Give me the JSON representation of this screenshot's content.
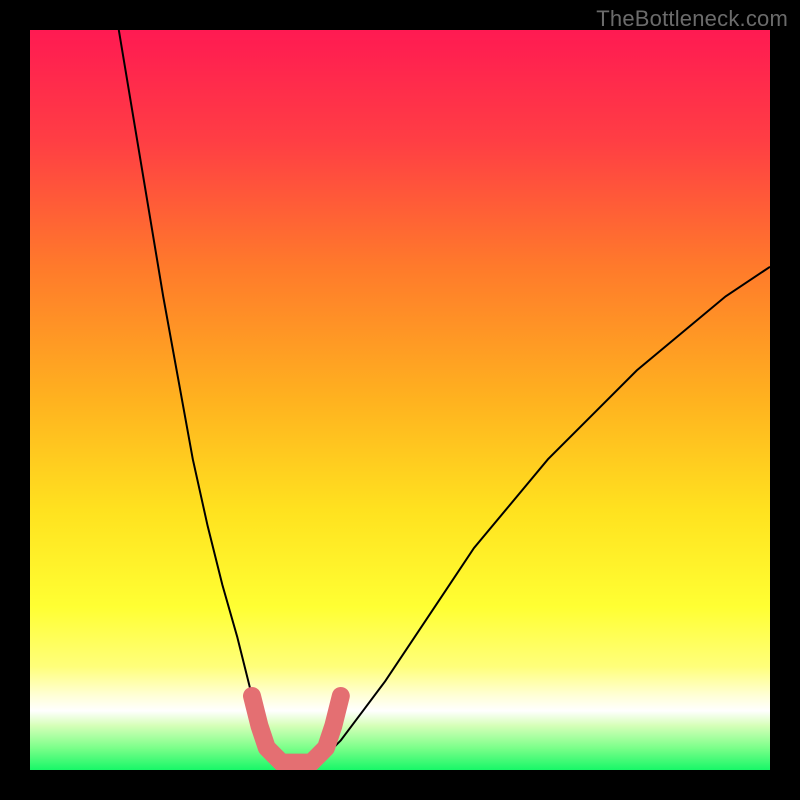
{
  "watermark": "TheBottleneck.com",
  "chart_data": {
    "type": "line",
    "title": "",
    "xlabel": "",
    "ylabel": "",
    "xlim": [
      0,
      100
    ],
    "ylim": [
      0,
      100
    ],
    "grid": false,
    "background_gradient": {
      "top_color": "#ff1a52",
      "mid_colors": [
        "#ff7a2b",
        "#ffd21f",
        "#ffff33",
        "#f7ffb0"
      ],
      "bottom_color": "#18f768",
      "description": "vertical red→orange→yellow→green gradient; thin white band ~y=10; green at y≈0"
    },
    "series": [
      {
        "name": "left-branch",
        "style": "black-thin-line",
        "x": [
          12,
          14,
          16,
          18,
          20,
          22,
          24,
          26,
          28,
          30,
          31,
          32,
          33,
          34
        ],
        "y": [
          100,
          88,
          76,
          64,
          53,
          42,
          33,
          25,
          18,
          10,
          7,
          5,
          3,
          2
        ]
      },
      {
        "name": "right-branch",
        "style": "black-thin-line",
        "x": [
          40,
          42,
          45,
          48,
          52,
          56,
          60,
          65,
          70,
          76,
          82,
          88,
          94,
          100
        ],
        "y": [
          2,
          4,
          8,
          12,
          18,
          24,
          30,
          36,
          42,
          48,
          54,
          59,
          64,
          68
        ]
      },
      {
        "name": "minimum-marker",
        "style": "salmon-thick-rounded",
        "x": [
          30,
          31,
          32,
          33,
          34,
          35,
          36,
          37,
          38,
          39,
          40,
          41,
          42
        ],
        "y": [
          10,
          6,
          3,
          2,
          1,
          1,
          1,
          1,
          1,
          2,
          3,
          6,
          10
        ]
      }
    ],
    "annotations": []
  },
  "colors": {
    "curve": "#000000",
    "marker": "#e46f72",
    "watermark": "#6b6b6b"
  }
}
